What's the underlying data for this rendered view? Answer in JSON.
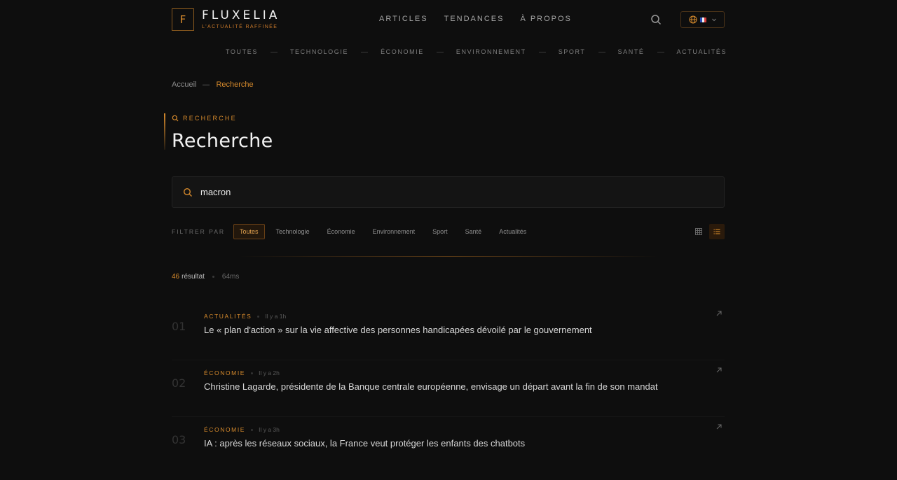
{
  "brand": {
    "letter": "F",
    "name": "FLUXELIA",
    "tagline": "L'ACTUALITÉ RAFFINÉE"
  },
  "mainnav": [
    "ARTICLES",
    "TENDANCES",
    "À PROPOS"
  ],
  "categories": [
    "TOUTES",
    "TECHNOLOGIE",
    "ÉCONOMIE",
    "ENVIRONNEMENT",
    "SPORT",
    "SANTÉ",
    "ACTUALITÉS"
  ],
  "breadcrumb": {
    "home": "Accueil",
    "current": "Recherche"
  },
  "page": {
    "eyebrow": "RECHERCHE",
    "title": "Recherche"
  },
  "search": {
    "value": "macron"
  },
  "filters": {
    "label": "FILTRER PAR",
    "chips": [
      "Toutes",
      "Technologie",
      "Économie",
      "Environnement",
      "Sport",
      "Santé",
      "Actualités"
    ],
    "active": "Toutes"
  },
  "stats": {
    "count": "46",
    "word": "résultat",
    "time": "64ms"
  },
  "results": [
    {
      "num": "01",
      "category": "ACTUALITÉS",
      "ago": "Il y a 1h",
      "headline": "Le « plan d'action » sur la vie affective des personnes handicapées dévoilé par le gouvernement"
    },
    {
      "num": "02",
      "category": "ÉCONOMIE",
      "ago": "Il y a 2h",
      "headline": "Christine Lagarde, présidente de la Banque centrale européenne, envisage un départ avant la fin de son mandat"
    },
    {
      "num": "03",
      "category": "ÉCONOMIE",
      "ago": "Il y a 3h",
      "headline": "IA : après les réseaux sociaux, la France veut protéger les enfants des chatbots"
    }
  ],
  "colors": {
    "accent": "#d68a2c",
    "background": "#0e0e0e"
  },
  "icons": [
    "search-icon",
    "globe-icon",
    "flag-fr-icon",
    "chevron-down-icon",
    "grid-view-icon",
    "list-view-icon",
    "external-arrow-icon"
  ]
}
